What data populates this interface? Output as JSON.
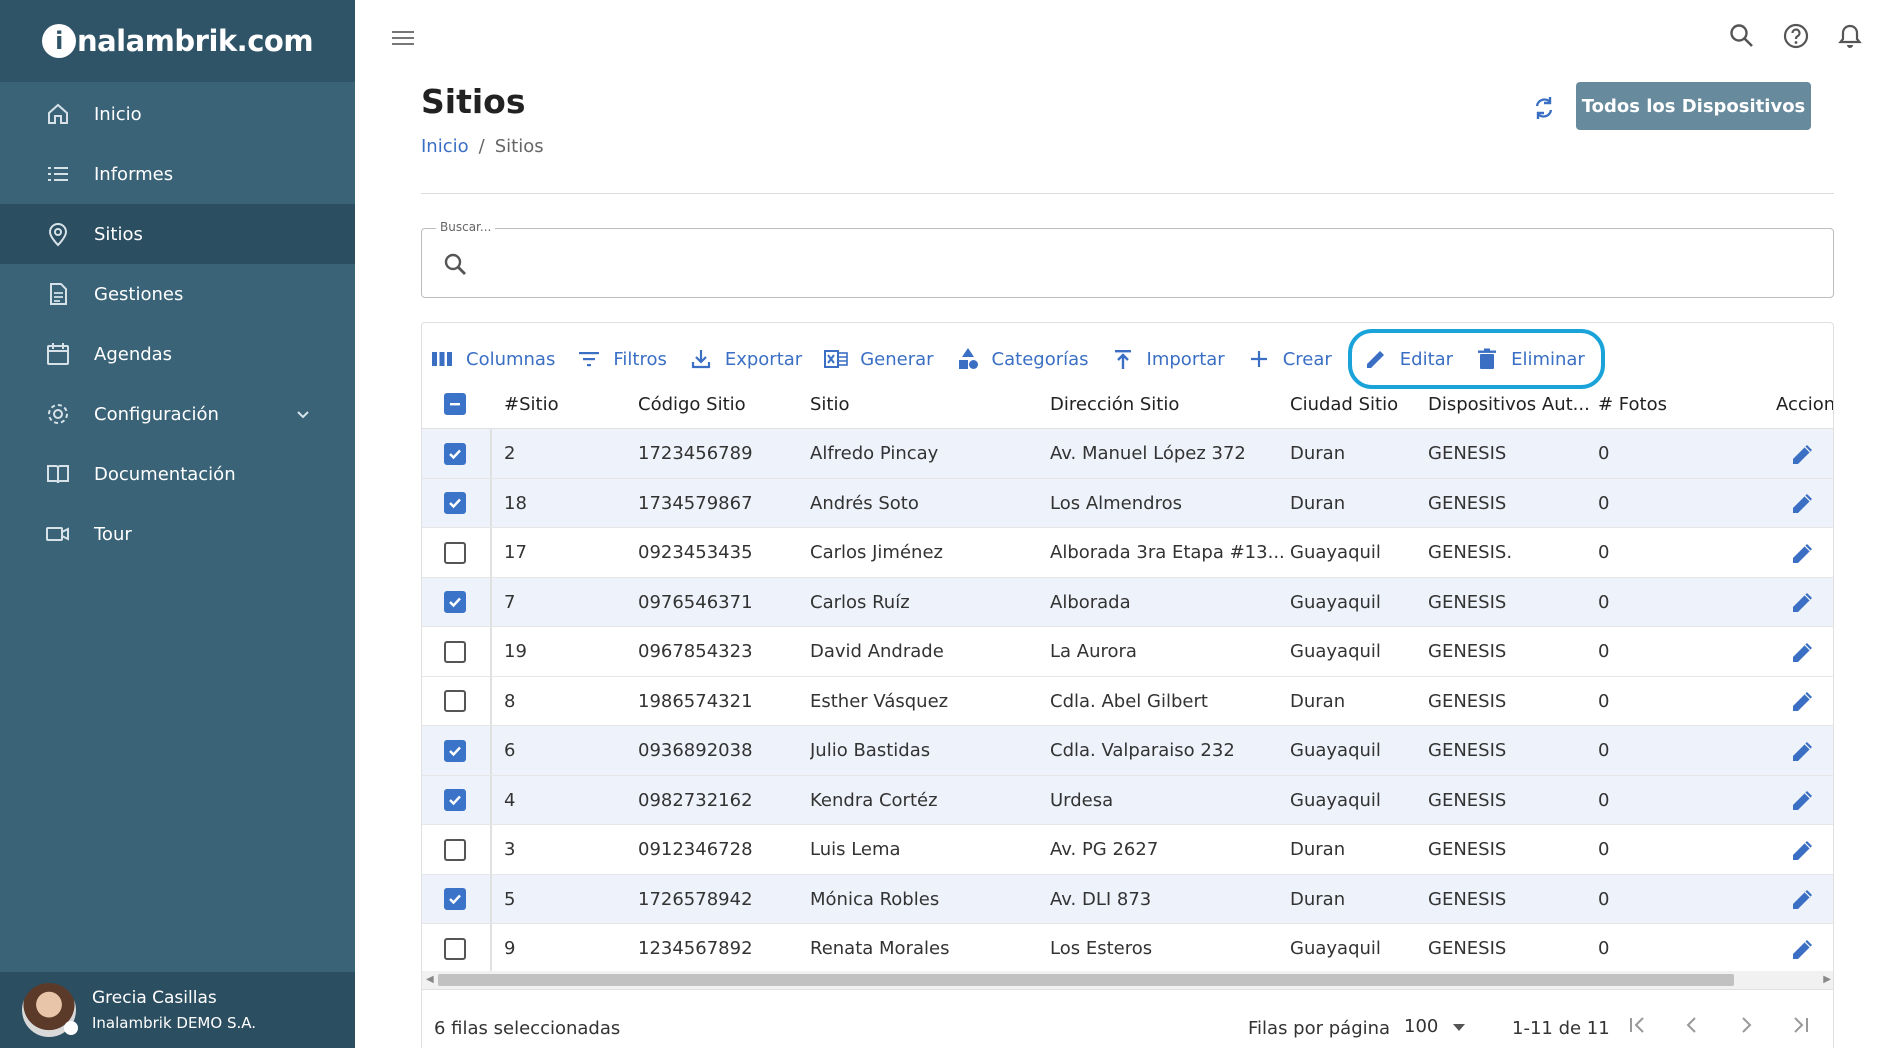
{
  "brand": {
    "logo_letter": "i",
    "logo_text": "nalambrik.com"
  },
  "sidebar": {
    "items": [
      {
        "label": "Inicio",
        "icon": "home-icon"
      },
      {
        "label": "Informes",
        "icon": "list-icon"
      },
      {
        "label": "Sitios",
        "icon": "location-pin-icon",
        "active": true
      },
      {
        "label": "Gestiones",
        "icon": "document-icon"
      },
      {
        "label": "Agendas",
        "icon": "calendar-icon"
      },
      {
        "label": "Configuración",
        "icon": "gear-icon",
        "expandable": true
      },
      {
        "label": "Documentación",
        "icon": "book-icon"
      },
      {
        "label": "Tour",
        "icon": "video-camera-icon"
      }
    ],
    "user": {
      "name": "Grecia Casillas",
      "org": "Inalambrik DEMO S.A."
    }
  },
  "header": {
    "title": "Sitios",
    "breadcrumb": {
      "home": "Inicio",
      "separator": "/",
      "current": "Sitios"
    },
    "primary_button": "Todos los Dispositivos"
  },
  "search": {
    "label": "Buscar...",
    "value": ""
  },
  "toolbar": {
    "columns": "Columnas",
    "filters": "Filtros",
    "export": "Exportar",
    "generate": "Generar",
    "categories": "Categorías",
    "import": "Importar",
    "create": "Crear",
    "edit": "Editar",
    "delete": "Eliminar"
  },
  "table": {
    "columns": [
      "#Sitio",
      "Código Sitio",
      "Sitio",
      "Dirección Sitio",
      "Ciudad Sitio",
      "Dispositivos Aut...",
      "# Fotos",
      "Accion"
    ],
    "rows": [
      {
        "selected": true,
        "cells": [
          "2",
          "1723456789",
          "Alfredo Pincay",
          "Av. Manuel López 372",
          "Duran",
          "GENESIS",
          "0"
        ]
      },
      {
        "selected": true,
        "cells": [
          "18",
          "1734579867",
          "Andrés Soto",
          "Los Almendros",
          "Duran",
          "GENESIS",
          "0"
        ]
      },
      {
        "selected": false,
        "cells": [
          "17",
          "0923453435",
          "Carlos Jiménez",
          "Alborada 3ra Etapa #13...",
          "Guayaquil",
          "GENESIS.",
          "0"
        ]
      },
      {
        "selected": true,
        "cells": [
          "7",
          "0976546371",
          "Carlos Ruíz",
          "Alborada",
          "Guayaquil",
          "GENESIS",
          "0"
        ]
      },
      {
        "selected": false,
        "cells": [
          "19",
          "0967854323",
          "David Andrade",
          "La Aurora",
          "Guayaquil",
          "GENESIS",
          "0"
        ]
      },
      {
        "selected": false,
        "cells": [
          "8",
          "1986574321",
          "Esther Vásquez",
          "Cdla. Abel Gilbert",
          "Duran",
          "GENESIS",
          "0"
        ]
      },
      {
        "selected": true,
        "cells": [
          "6",
          "0936892038",
          "Julio Bastidas",
          "Cdla. Valparaiso 232",
          "Guayaquil",
          "GENESIS",
          "0"
        ]
      },
      {
        "selected": true,
        "cells": [
          "4",
          "0982732162",
          "Kendra Cortéz",
          "Urdesa",
          "Guayaquil",
          "GENESIS",
          "0"
        ]
      },
      {
        "selected": false,
        "cells": [
          "3",
          "0912346728",
          "Luis Lema",
          "Av. PG 2627",
          "Duran",
          "GENESIS",
          "0"
        ]
      },
      {
        "selected": true,
        "cells": [
          "5",
          "1726578942",
          "Mónica Robles",
          "Av. DLI 873",
          "Duran",
          "GENESIS",
          "0"
        ]
      },
      {
        "selected": false,
        "cells": [
          "9",
          "1234567892",
          "Renata Morales",
          "Los Esteros",
          "Guayaquil",
          "GENESIS",
          "0"
        ]
      }
    ]
  },
  "footer": {
    "selected_text": "6 filas seleccionadas",
    "rows_per_page_label": "Filas por página",
    "rows_per_page_value": "100",
    "range": "1-11 de 11"
  },
  "colors": {
    "sidebar": "#3a6378",
    "sidebar_active": "#2c4e61",
    "accent": "#3a6fc4",
    "highlight": "#1aa3d9",
    "primary_button": "#678a9c"
  }
}
